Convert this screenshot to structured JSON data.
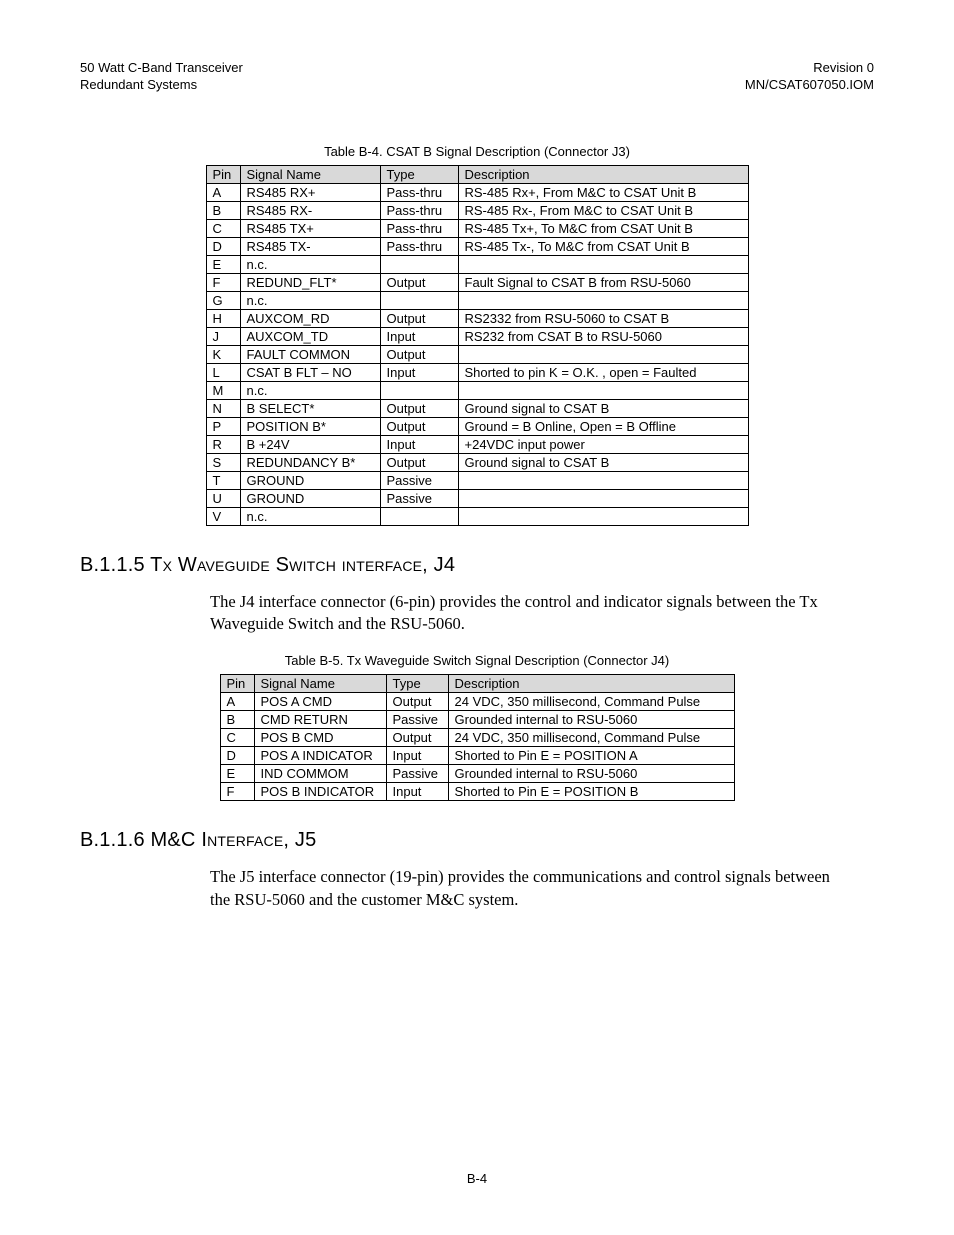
{
  "header": {
    "left_line1": "50 Watt C-Band Transceiver",
    "left_line2": "Redundant Systems",
    "right_line1": "Revision 0",
    "right_line2": "MN/CSAT607050.IOM"
  },
  "table1": {
    "caption": "Table B-4.   CSAT B Signal Description (Connector J3)",
    "headers": [
      "Pin",
      "Signal Name",
      "Type",
      "Description"
    ],
    "rows": [
      [
        "A",
        "RS485 RX+",
        "Pass-thru",
        "RS-485 Rx+, From M&C to CSAT Unit B"
      ],
      [
        "B",
        "RS485 RX-",
        "Pass-thru",
        "RS-485 Rx-, From M&C to CSAT Unit B"
      ],
      [
        "C",
        "RS485 TX+",
        "Pass-thru",
        "RS-485 Tx+, To M&C from CSAT Unit B"
      ],
      [
        "D",
        "RS485 TX-",
        "Pass-thru",
        "RS-485 Tx-, To M&C from CSAT Unit B"
      ],
      [
        "E",
        "n.c.",
        "",
        ""
      ],
      [
        "F",
        "REDUND_FLT*",
        "Output",
        "Fault Signal to CSAT B from RSU-5060"
      ],
      [
        "G",
        "n.c.",
        "",
        ""
      ],
      [
        "H",
        "AUXCOM_RD",
        "Output",
        "RS2332 from RSU-5060 to CSAT B"
      ],
      [
        "J",
        "AUXCOM_TD",
        "Input",
        "RS232 from CSAT B to RSU-5060"
      ],
      [
        "K",
        "FAULT COMMON",
        "Output",
        ""
      ],
      [
        "L",
        "CSAT B FLT – NO",
        "Input",
        "Shorted to pin K = O.K. , open = Faulted"
      ],
      [
        "M",
        "n.c.",
        "",
        ""
      ],
      [
        "N",
        "B SELECT*",
        "Output",
        "Ground signal to CSAT B"
      ],
      [
        "P",
        "POSITION B*",
        "Output",
        "Ground = B Online, Open = B Offline"
      ],
      [
        "R",
        "B +24V",
        "Input",
        "+24VDC input power"
      ],
      [
        "S",
        "REDUNDANCY B*",
        "Output",
        "Ground signal to CSAT B"
      ],
      [
        "T",
        "GROUND",
        "Passive",
        ""
      ],
      [
        "U",
        "GROUND",
        "Passive",
        ""
      ],
      [
        "V",
        "n.c.",
        "",
        ""
      ]
    ]
  },
  "section1": {
    "heading": "B.1.1.5 Tx Waveguide Switch interface, J4",
    "paragraph": "The J4 interface connector (6-pin) provides the control and indicator signals between the Tx Waveguide Switch and the RSU-5060."
  },
  "table2": {
    "caption": "Table B-5.  Tx Waveguide Switch Signal Description (Connector J4)",
    "headers": [
      "Pin",
      "Signal Name",
      "Type",
      "Description"
    ],
    "rows": [
      [
        "A",
        "POS A CMD",
        "Output",
        "24 VDC, 350 millisecond, Command Pulse"
      ],
      [
        "B",
        "CMD RETURN",
        "Passive",
        "Grounded internal to RSU-5060"
      ],
      [
        "C",
        "POS B CMD",
        "Output",
        "24 VDC, 350 millisecond, Command Pulse"
      ],
      [
        "D",
        "POS A INDICATOR",
        "Input",
        "Shorted to Pin E = POSITION A"
      ],
      [
        "E",
        "IND COMMOM",
        "Passive",
        "Grounded internal to RSU-5060"
      ],
      [
        "F",
        "POS B INDICATOR",
        "Input",
        "Shorted to Pin E = POSITION B"
      ]
    ]
  },
  "section2": {
    "heading": "B.1.1.6 M&C Interface, J5",
    "paragraph": "The J5 interface connector (19-pin) provides the communications and control signals between the RSU-5060 and the customer M&C system."
  },
  "page_number": "B-4"
}
